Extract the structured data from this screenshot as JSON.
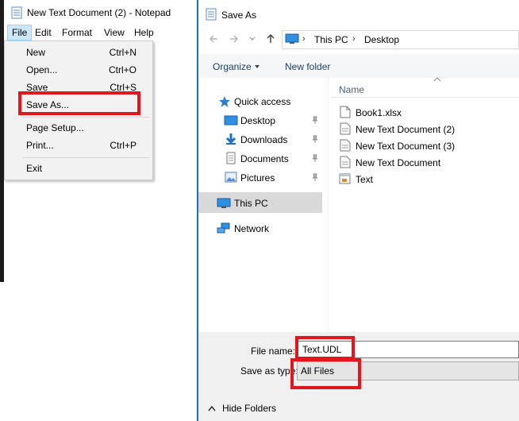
{
  "notepad": {
    "title": "New Text Document (2) - Notepad",
    "menu": [
      "File",
      "Edit",
      "Format",
      "View",
      "Help"
    ],
    "file_menu": [
      {
        "label": "New",
        "shortcut": "Ctrl+N"
      },
      {
        "label": "Open...",
        "shortcut": "Ctrl+O"
      },
      {
        "label": "Save",
        "shortcut": "Ctrl+S"
      },
      {
        "label": "Save As...",
        "shortcut": ""
      },
      {
        "label": "Page Setup...",
        "shortcut": ""
      },
      {
        "label": "Print...",
        "shortcut": "Ctrl+P"
      },
      {
        "label": "Exit",
        "shortcut": ""
      }
    ]
  },
  "save_as": {
    "title": "Save As",
    "breadcrumb": [
      "This PC",
      "Desktop"
    ],
    "toolbar": {
      "organize": "Organize",
      "new_folder": "New folder"
    },
    "nav": {
      "quick_access": "Quick access",
      "pinned": [
        "Desktop",
        "Downloads",
        "Documents",
        "Pictures"
      ],
      "this_pc": "This PC",
      "network": "Network"
    },
    "column_header": "Name",
    "files": [
      "Book1.xlsx",
      "New Text Document (2)",
      "New Text Document (3)",
      "New Text Document",
      "Text"
    ],
    "file_name_label": "File name:",
    "file_name_value": "Text.UDL",
    "save_type_label": "Save as type:",
    "save_type_value": "All Files",
    "hide_folders": "Hide Folders"
  },
  "colors": {
    "highlight": "#e2171e",
    "selection": "#cce8ff",
    "folder": "#dcb64f",
    "accent": "#1a6ec6"
  }
}
